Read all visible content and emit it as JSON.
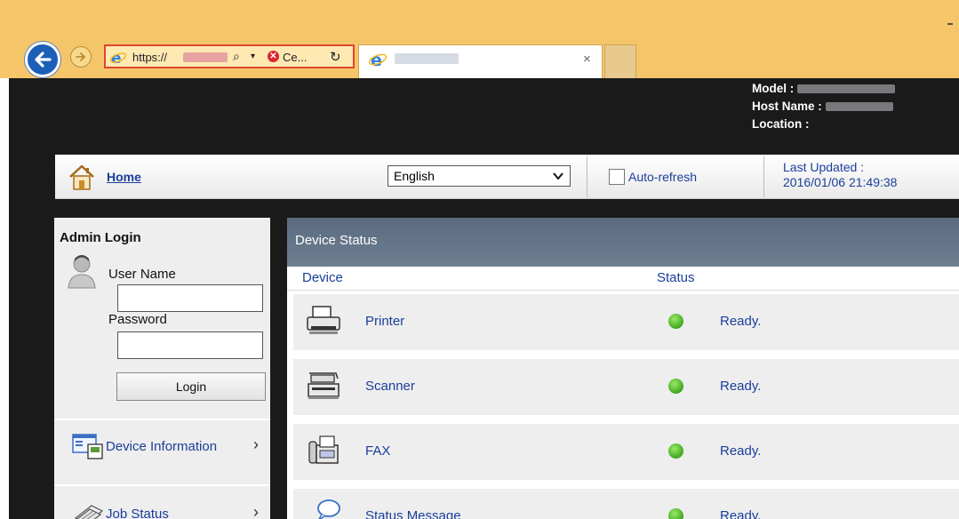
{
  "browser": {
    "address": {
      "url_prefix": "https://",
      "cert_label": "Ce..."
    },
    "tab": {
      "close_glyph": "×"
    }
  },
  "device_info": {
    "model_label": "Model :",
    "host_label": "Host Name :",
    "location_label": "Location :"
  },
  "header": {
    "home_label": "Home",
    "language": {
      "selected": "English"
    },
    "auto_refresh_label": "Auto-refresh",
    "last_updated_label": "Last Updated :",
    "last_updated_value": "2016/01/06 21:49:38"
  },
  "login": {
    "title": "Admin Login",
    "username_label": "User Name",
    "password_label": "Password",
    "username_value": "",
    "password_value": "",
    "button_label": "Login"
  },
  "side_nav": [
    {
      "label": "Device Information",
      "arrow": "›"
    },
    {
      "label": "Job Status",
      "arrow": "›"
    }
  ],
  "status_panel": {
    "title": "Device Status",
    "columns": {
      "device": "Device",
      "status": "Status"
    },
    "rows": [
      {
        "device": "Printer",
        "status": "Ready.",
        "icon": "printer-icon",
        "status_color": "#4caf2a"
      },
      {
        "device": "Scanner",
        "status": "Ready.",
        "icon": "scanner-icon",
        "status_color": "#4caf2a"
      },
      {
        "device": "FAX",
        "status": "Ready.",
        "icon": "fax-icon",
        "status_color": "#4caf2a"
      },
      {
        "device": "Status Message",
        "status": "Ready.",
        "icon": "status-message-icon",
        "status_color": "#4caf2a"
      }
    ]
  },
  "colors": {
    "chrome": "#f5c669",
    "page_bg": "#1a1a1a",
    "link": "#1b3e9b",
    "panel_header": "#66768a",
    "status_ok": "#4caf2a"
  }
}
